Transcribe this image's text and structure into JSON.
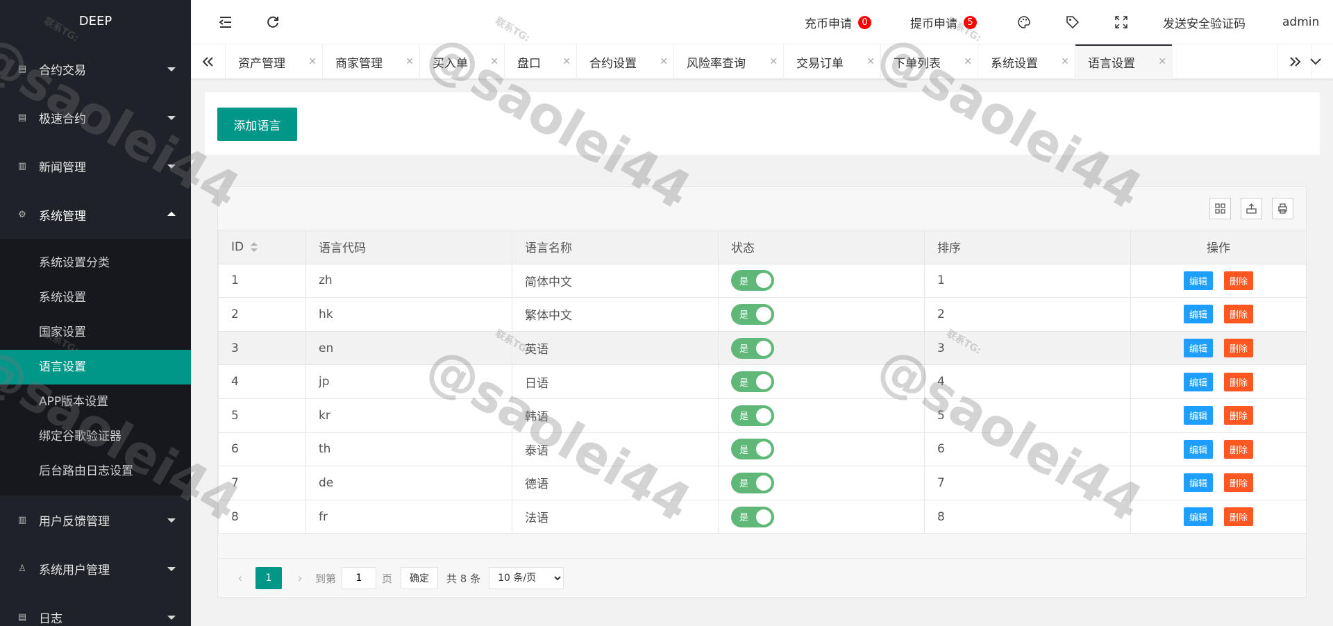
{
  "app": {
    "title": "DEEP"
  },
  "sidebar": {
    "items": [
      {
        "label": "合约交易"
      },
      {
        "label": "极速合约"
      },
      {
        "label": "新闻管理"
      },
      {
        "label": "系统管理"
      }
    ],
    "sub_items": [
      {
        "label": "系统设置分类"
      },
      {
        "label": "系统设置"
      },
      {
        "label": "国家设置"
      },
      {
        "label": "语言设置"
      },
      {
        "label": "APP版本设置"
      },
      {
        "label": "绑定谷歌验证器"
      },
      {
        "label": "后台路由日志设置"
      }
    ],
    "bottom_items": [
      {
        "label": "用户反馈管理"
      },
      {
        "label": "系统用户管理"
      },
      {
        "label": "日志"
      }
    ]
  },
  "header": {
    "deposit_label": "充币申请",
    "deposit_count": "0",
    "withdraw_label": "提币申请",
    "withdraw_count": "5",
    "security_code_label": "发送安全验证码",
    "user": "admin"
  },
  "tabs": [
    {
      "label": "资产管理"
    },
    {
      "label": "商家管理"
    },
    {
      "label": "买入单"
    },
    {
      "label": "盘口"
    },
    {
      "label": "合约设置"
    },
    {
      "label": "风险率查询"
    },
    {
      "label": "交易订单"
    },
    {
      "label": "下单列表"
    },
    {
      "label": "系统设置"
    },
    {
      "label": "语言设置"
    }
  ],
  "toolbar": {
    "add_label": "添加语言"
  },
  "table": {
    "headers": {
      "id": "ID",
      "code": "语言代码",
      "name": "语言名称",
      "status": "状态",
      "sort": "排序",
      "ops": "操作"
    },
    "switch_label": "是",
    "edit_label": "编辑",
    "delete_label": "删除",
    "rows": [
      {
        "id": "1",
        "code": "zh",
        "name": "简体中文",
        "sort": "1"
      },
      {
        "id": "2",
        "code": "hk",
        "name": "繁体中文",
        "sort": "2"
      },
      {
        "id": "3",
        "code": "en",
        "name": "英语",
        "sort": "3"
      },
      {
        "id": "4",
        "code": "jp",
        "name": "日语",
        "sort": "4"
      },
      {
        "id": "5",
        "code": "kr",
        "name": "韩语",
        "sort": "5"
      },
      {
        "id": "6",
        "code": "th",
        "name": "泰语",
        "sort": "6"
      },
      {
        "id": "7",
        "code": "de",
        "name": "德语",
        "sort": "7"
      },
      {
        "id": "8",
        "code": "fr",
        "name": "法语",
        "sort": "8"
      }
    ]
  },
  "pager": {
    "current": "1",
    "goto_label": "到第",
    "goto_value": "1",
    "page_unit": "页",
    "confirm_label": "确定",
    "total_label": "共 8 条",
    "page_size": "10 条/页"
  },
  "watermark": {
    "line1": "联系TG:",
    "line2": "@saolei44"
  },
  "colors": {
    "primary": "#009688",
    "sidebar": "#20222a",
    "edit": "#1e9fff",
    "delete": "#ff5722",
    "switch_on": "#5fb878",
    "badge": "#ff0000"
  }
}
